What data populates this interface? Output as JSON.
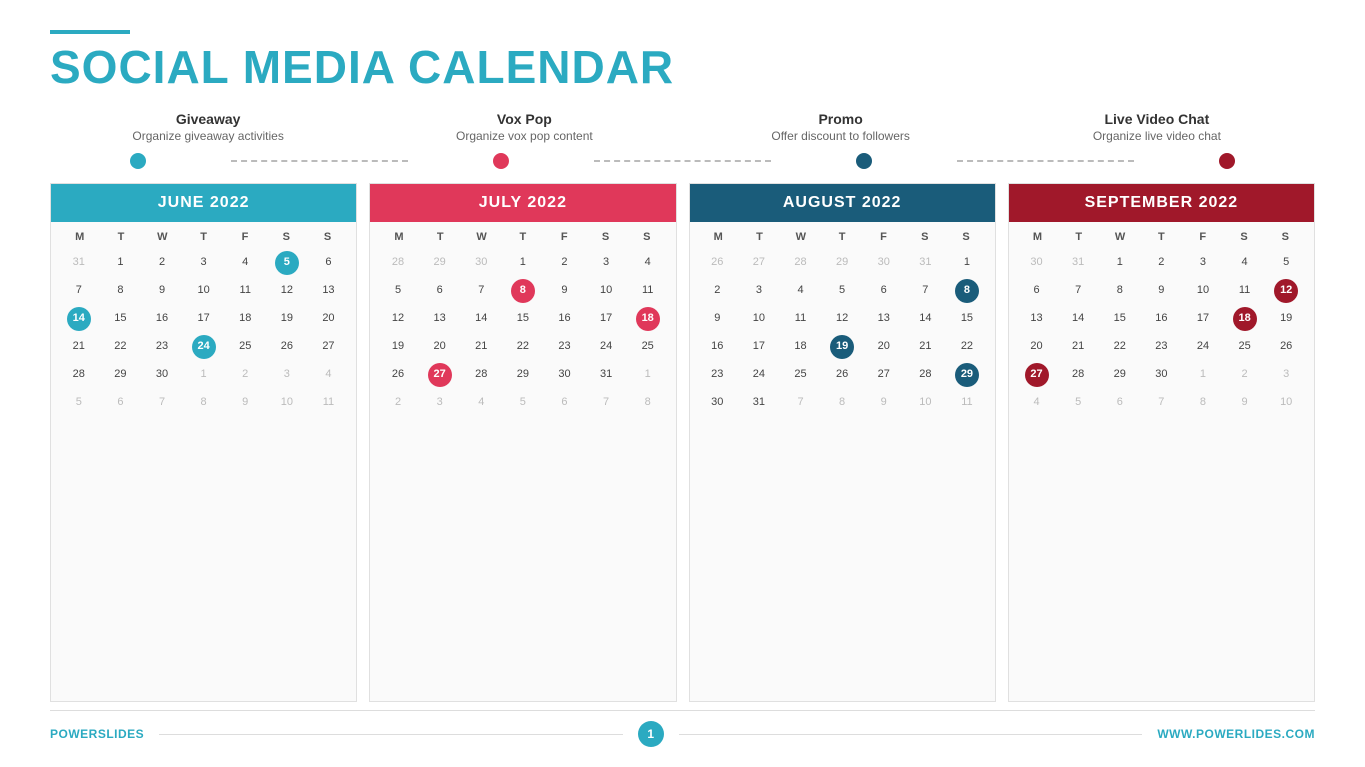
{
  "header": {
    "line_color": "#2baac1",
    "title_part1": "SOCIAL MEDIA ",
    "title_part2": "CALENDAR"
  },
  "categories": [
    {
      "name": "Giveaway",
      "desc": "Organize giveaway activities",
      "dot_class": "blue"
    },
    {
      "name": "Vox Pop",
      "desc": "Organize vox pop content",
      "dot_class": "red"
    },
    {
      "name": "Promo",
      "desc": "Offer discount to followers",
      "dot_class": "darkblue"
    },
    {
      "name": "Live Video Chat",
      "desc": "Organize live video chat",
      "dot_class": "darkred"
    }
  ],
  "calendars": [
    {
      "title": "JUNE 2022",
      "header_class": "teal",
      "highlight_class": "highlight-teal",
      "day_headers": [
        "M",
        "T",
        "W",
        "T",
        "F",
        "S",
        "S"
      ],
      "days": [
        {
          "label": "31",
          "class": "other-month"
        },
        {
          "label": "1",
          "class": ""
        },
        {
          "label": "2",
          "class": ""
        },
        {
          "label": "3",
          "class": ""
        },
        {
          "label": "4",
          "class": ""
        },
        {
          "label": "5",
          "class": "highlight-teal"
        },
        {
          "label": "6",
          "class": ""
        },
        {
          "label": "7",
          "class": ""
        },
        {
          "label": "8",
          "class": ""
        },
        {
          "label": "9",
          "class": ""
        },
        {
          "label": "10",
          "class": ""
        },
        {
          "label": "11",
          "class": ""
        },
        {
          "label": "12",
          "class": ""
        },
        {
          "label": "13",
          "class": ""
        },
        {
          "label": "14",
          "class": "highlight-teal"
        },
        {
          "label": "15",
          "class": ""
        },
        {
          "label": "16",
          "class": ""
        },
        {
          "label": "17",
          "class": ""
        },
        {
          "label": "18",
          "class": ""
        },
        {
          "label": "19",
          "class": ""
        },
        {
          "label": "20",
          "class": ""
        },
        {
          "label": "21",
          "class": ""
        },
        {
          "label": "22",
          "class": ""
        },
        {
          "label": "23",
          "class": ""
        },
        {
          "label": "24",
          "class": "highlight-teal"
        },
        {
          "label": "25",
          "class": ""
        },
        {
          "label": "26",
          "class": ""
        },
        {
          "label": "27",
          "class": ""
        },
        {
          "label": "28",
          "class": ""
        },
        {
          "label": "29",
          "class": ""
        },
        {
          "label": "30",
          "class": ""
        },
        {
          "label": "1",
          "class": "other-month"
        },
        {
          "label": "2",
          "class": "other-month"
        },
        {
          "label": "3",
          "class": "other-month"
        },
        {
          "label": "4",
          "class": "other-month"
        },
        {
          "label": "5",
          "class": "other-month"
        },
        {
          "label": "6",
          "class": "other-month"
        },
        {
          "label": "7",
          "class": "other-month"
        },
        {
          "label": "8",
          "class": "other-month"
        },
        {
          "label": "9",
          "class": "other-month"
        },
        {
          "label": "10",
          "class": "other-month"
        },
        {
          "label": "11",
          "class": "other-month"
        }
      ]
    },
    {
      "title": "JULY 2022",
      "header_class": "pink",
      "highlight_class": "highlight-pink",
      "day_headers": [
        "M",
        "T",
        "W",
        "T",
        "F",
        "S",
        "S"
      ],
      "days": [
        {
          "label": "28",
          "class": "other-month"
        },
        {
          "label": "29",
          "class": "other-month"
        },
        {
          "label": "30",
          "class": "other-month"
        },
        {
          "label": "1",
          "class": ""
        },
        {
          "label": "2",
          "class": ""
        },
        {
          "label": "3",
          "class": ""
        },
        {
          "label": "4",
          "class": ""
        },
        {
          "label": "5",
          "class": ""
        },
        {
          "label": "6",
          "class": ""
        },
        {
          "label": "7",
          "class": ""
        },
        {
          "label": "8",
          "class": "highlight-pink"
        },
        {
          "label": "9",
          "class": ""
        },
        {
          "label": "10",
          "class": ""
        },
        {
          "label": "11",
          "class": ""
        },
        {
          "label": "12",
          "class": ""
        },
        {
          "label": "13",
          "class": ""
        },
        {
          "label": "14",
          "class": ""
        },
        {
          "label": "15",
          "class": ""
        },
        {
          "label": "16",
          "class": ""
        },
        {
          "label": "17",
          "class": ""
        },
        {
          "label": "18",
          "class": "highlight-pink"
        },
        {
          "label": "19",
          "class": ""
        },
        {
          "label": "20",
          "class": ""
        },
        {
          "label": "21",
          "class": ""
        },
        {
          "label": "22",
          "class": ""
        },
        {
          "label": "23",
          "class": ""
        },
        {
          "label": "24",
          "class": ""
        },
        {
          "label": "25",
          "class": ""
        },
        {
          "label": "26",
          "class": ""
        },
        {
          "label": "27",
          "class": "highlight-pink"
        },
        {
          "label": "28",
          "class": ""
        },
        {
          "label": "29",
          "class": ""
        },
        {
          "label": "30",
          "class": ""
        },
        {
          "label": "31",
          "class": ""
        },
        {
          "label": "1",
          "class": "other-month"
        },
        {
          "label": "2",
          "class": "other-month"
        },
        {
          "label": "3",
          "class": "other-month"
        },
        {
          "label": "4",
          "class": "other-month"
        },
        {
          "label": "5",
          "class": "other-month"
        },
        {
          "label": "6",
          "class": "other-month"
        },
        {
          "label": "7",
          "class": "other-month"
        },
        {
          "label": "8",
          "class": "other-month"
        }
      ]
    },
    {
      "title": "AUGUST 2022",
      "header_class": "darkblue",
      "highlight_class": "highlight-darkblue",
      "day_headers": [
        "M",
        "T",
        "W",
        "T",
        "F",
        "S",
        "S"
      ],
      "days": [
        {
          "label": "26",
          "class": "other-month"
        },
        {
          "label": "27",
          "class": "other-month"
        },
        {
          "label": "28",
          "class": "other-month"
        },
        {
          "label": "29",
          "class": "other-month"
        },
        {
          "label": "30",
          "class": "other-month"
        },
        {
          "label": "31",
          "class": "other-month"
        },
        {
          "label": "1",
          "class": ""
        },
        {
          "label": "2",
          "class": ""
        },
        {
          "label": "3",
          "class": ""
        },
        {
          "label": "4",
          "class": ""
        },
        {
          "label": "5",
          "class": ""
        },
        {
          "label": "6",
          "class": ""
        },
        {
          "label": "7",
          "class": ""
        },
        {
          "label": "8",
          "class": "highlight-darkblue"
        },
        {
          "label": "9",
          "class": ""
        },
        {
          "label": "10",
          "class": ""
        },
        {
          "label": "11",
          "class": ""
        },
        {
          "label": "12",
          "class": ""
        },
        {
          "label": "13",
          "class": ""
        },
        {
          "label": "14",
          "class": ""
        },
        {
          "label": "15",
          "class": ""
        },
        {
          "label": "16",
          "class": ""
        },
        {
          "label": "17",
          "class": ""
        },
        {
          "label": "18",
          "class": ""
        },
        {
          "label": "19",
          "class": "highlight-darkblue"
        },
        {
          "label": "20",
          "class": ""
        },
        {
          "label": "21",
          "class": ""
        },
        {
          "label": "22",
          "class": ""
        },
        {
          "label": "23",
          "class": ""
        },
        {
          "label": "24",
          "class": ""
        },
        {
          "label": "25",
          "class": ""
        },
        {
          "label": "26",
          "class": ""
        },
        {
          "label": "27",
          "class": ""
        },
        {
          "label": "28",
          "class": ""
        },
        {
          "label": "29",
          "class": "highlight-darkblue"
        },
        {
          "label": "30",
          "class": ""
        },
        {
          "label": "31",
          "class": ""
        },
        {
          "label": "7",
          "class": "other-month"
        },
        {
          "label": "8",
          "class": "other-month"
        },
        {
          "label": "9",
          "class": "other-month"
        },
        {
          "label": "10",
          "class": "other-month"
        },
        {
          "label": "11",
          "class": "other-month"
        }
      ]
    },
    {
      "title": "SEPTEMBER 2022",
      "header_class": "darkred",
      "highlight_class": "highlight-darkred",
      "day_headers": [
        "M",
        "T",
        "W",
        "T",
        "F",
        "S",
        "S"
      ],
      "days": [
        {
          "label": "30",
          "class": "other-month"
        },
        {
          "label": "31",
          "class": "other-month"
        },
        {
          "label": "1",
          "class": ""
        },
        {
          "label": "2",
          "class": ""
        },
        {
          "label": "3",
          "class": ""
        },
        {
          "label": "4",
          "class": ""
        },
        {
          "label": "5",
          "class": ""
        },
        {
          "label": "6",
          "class": ""
        },
        {
          "label": "7",
          "class": ""
        },
        {
          "label": "8",
          "class": ""
        },
        {
          "label": "9",
          "class": ""
        },
        {
          "label": "10",
          "class": ""
        },
        {
          "label": "11",
          "class": ""
        },
        {
          "label": "12",
          "class": "highlight-darkred"
        },
        {
          "label": "13",
          "class": ""
        },
        {
          "label": "14",
          "class": ""
        },
        {
          "label": "15",
          "class": ""
        },
        {
          "label": "16",
          "class": ""
        },
        {
          "label": "17",
          "class": ""
        },
        {
          "label": "18",
          "class": "highlight-darkred"
        },
        {
          "label": "19",
          "class": ""
        },
        {
          "label": "20",
          "class": ""
        },
        {
          "label": "21",
          "class": ""
        },
        {
          "label": "22",
          "class": ""
        },
        {
          "label": "23",
          "class": ""
        },
        {
          "label": "24",
          "class": ""
        },
        {
          "label": "25",
          "class": ""
        },
        {
          "label": "26",
          "class": ""
        },
        {
          "label": "27",
          "class": "highlight-darkred"
        },
        {
          "label": "28",
          "class": ""
        },
        {
          "label": "29",
          "class": ""
        },
        {
          "label": "30",
          "class": ""
        },
        {
          "label": "1",
          "class": "other-month"
        },
        {
          "label": "2",
          "class": "other-month"
        },
        {
          "label": "3",
          "class": "other-month"
        },
        {
          "label": "4",
          "class": "other-month"
        },
        {
          "label": "5",
          "class": "other-month"
        },
        {
          "label": "6",
          "class": "other-month"
        },
        {
          "label": "7",
          "class": "other-month"
        },
        {
          "label": "8",
          "class": "other-month"
        },
        {
          "label": "9",
          "class": "other-month"
        },
        {
          "label": "10",
          "class": "other-month"
        }
      ]
    }
  ],
  "footer": {
    "brand_part1": "POWER",
    "brand_part2": "SLIDES",
    "page_number": "1",
    "website": "WWW.POWERLIDES.COM"
  }
}
